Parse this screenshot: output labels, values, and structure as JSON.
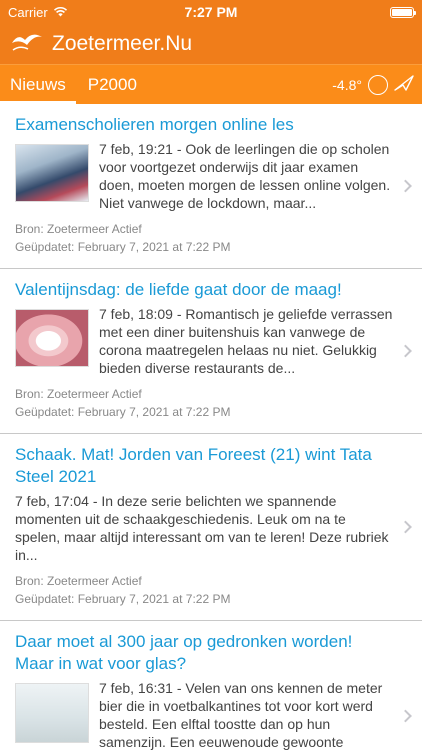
{
  "status_bar": {
    "carrier": "Carrier",
    "time": "7:27 PM"
  },
  "app": {
    "title": "Zoetermeer.Nu"
  },
  "tabs": [
    {
      "label": "Nieuws",
      "active": true
    },
    {
      "label": "P2000",
      "active": false
    }
  ],
  "weather": {
    "temperature": "-4.8°"
  },
  "news": [
    {
      "title": "Examenscholieren morgen online les",
      "summary": " 7 feb, 19:21 - Ook de leerlingen die op scholen voor voortgezet onderwijs dit jaar examen doen, moeten morgen de lessen online volgen. Niet vanwege de lockdown, maar...",
      "source": "Bron: Zoetermeer Actief",
      "updated": "Geüpdatet: February 7, 2021 at 7:22 PM"
    },
    {
      "title": "Valentijnsdag: de liefde gaat door de maag!",
      "summary": " 7 feb, 18:09 - Romantisch je geliefde verrassen met een diner buitenshuis kan vanwege de corona maatregelen helaas nu niet. Gelukkig bieden diverse restaurants de...",
      "source": "Bron: Zoetermeer Actief",
      "updated": "Geüpdatet: February 7, 2021 at 7:22 PM"
    },
    {
      "title": "Schaak. Mat! Jorden van Foreest (21) wint Tata Steel 2021",
      "summary": " 7 feb, 17:04 - In deze serie belichten we spannende momenten uit de schaakgeschiedenis. Leuk om na te spelen, maar altijd interessant om van te leren! Deze rubriek in...",
      "source": "Bron: Zoetermeer Actief",
      "updated": "Geüpdatet: February 7, 2021 at 7:22 PM"
    },
    {
      "title": "Daar moet al 300 jaar op gedronken worden! Maar in wat voor glas?",
      "summary": " 7 feb, 16:31 - Velen van ons kennen de meter bier die in voetbalkantines tot voor kort werd besteld. Een elftal toostte dan op hun samenzijn. Een eeuwenoude gewoonte"
    }
  ]
}
